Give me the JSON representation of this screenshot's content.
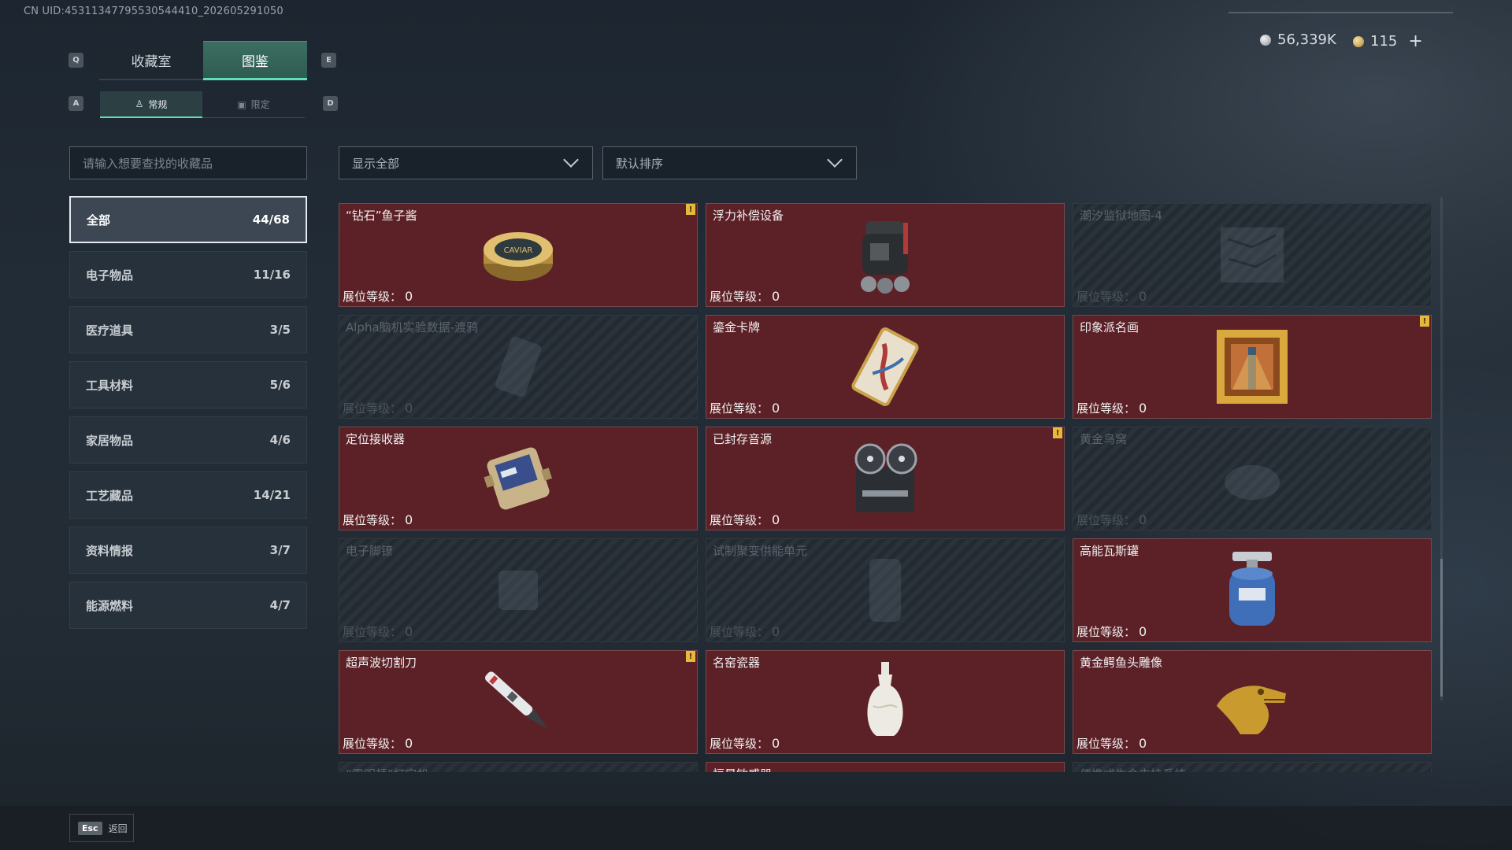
{
  "header": {
    "uid": "CN UID:4531134779553054441​0_202605291050",
    "keys": {
      "prev_tab": "Q",
      "next_tab": "E",
      "prev_sub": "A",
      "next_sub": "D"
    },
    "tabs": [
      {
        "label": "收藏室",
        "active": false
      },
      {
        "label": "图鉴",
        "active": true
      }
    ],
    "subtabs": [
      {
        "label": "常规",
        "active": true,
        "icon": "figure-icon"
      },
      {
        "label": "限定",
        "active": false,
        "icon": "image-icon"
      }
    ],
    "currency": {
      "silver": "56,339K",
      "gold": "115",
      "add": "+"
    }
  },
  "sidebar": {
    "search_placeholder": "请输入想要查找的收藏品",
    "categories": [
      {
        "label": "全部",
        "count": "44/68",
        "active": true
      },
      {
        "label": "电子物品",
        "count": "11/16"
      },
      {
        "label": "医疗道具",
        "count": "3/5"
      },
      {
        "label": "工具材料",
        "count": "5/6"
      },
      {
        "label": "家居物品",
        "count": "4/6"
      },
      {
        "label": "工艺藏品",
        "count": "14/21"
      },
      {
        "label": "资料情报",
        "count": "3/7"
      },
      {
        "label": "能源燃料",
        "count": "4/7"
      }
    ]
  },
  "filters": {
    "show": "显示全部",
    "sort": "默认排序"
  },
  "level_label": "展位等级：",
  "items": [
    {
      "name": "“钻石”鱼子酱",
      "level": "0",
      "owned": true,
      "new": true,
      "icon": "caviar-tin-icon"
    },
    {
      "name": "浮力补偿设备",
      "level": "0",
      "owned": true,
      "new": false,
      "icon": "buoyancy-device-icon"
    },
    {
      "name": "潮汐监狱地图-4",
      "level": "0",
      "owned": false,
      "new": false,
      "icon": "map-icon"
    },
    {
      "name": "Alpha脑机实验数据-渡鸦",
      "level": "0",
      "owned": false,
      "new": false,
      "icon": "data-drive-icon"
    },
    {
      "name": "鎏金卡牌",
      "level": "0",
      "owned": true,
      "new": false,
      "icon": "gilded-card-icon"
    },
    {
      "name": "印象派名画",
      "level": "0",
      "owned": true,
      "new": true,
      "icon": "painting-icon"
    },
    {
      "name": "定位接收器",
      "level": "0",
      "owned": true,
      "new": false,
      "icon": "receiver-icon"
    },
    {
      "name": "已封存音源",
      "level": "0",
      "owned": true,
      "new": true,
      "icon": "tape-recorder-icon"
    },
    {
      "name": "黄金鸟窝",
      "level": "0",
      "owned": false,
      "new": false,
      "icon": "bird-nest-icon"
    },
    {
      "name": "电子脚镣",
      "level": "0",
      "owned": false,
      "new": false,
      "icon": "ankle-monitor-icon"
    },
    {
      "name": "试制聚变供能单元",
      "level": "0",
      "owned": false,
      "new": false,
      "icon": "fusion-cell-icon"
    },
    {
      "name": "高能瓦斯罐",
      "level": "0",
      "owned": true,
      "new": false,
      "icon": "gas-canister-icon"
    },
    {
      "name": "超声波切割刀",
      "level": "0",
      "owned": true,
      "new": true,
      "icon": "ultrasonic-knife-icon"
    },
    {
      "name": "名窑瓷器",
      "level": "0",
      "owned": true,
      "new": false,
      "icon": "porcelain-vase-icon"
    },
    {
      "name": "黄金鳄鱼头雕像",
      "level": "0",
      "owned": true,
      "new": false,
      "icon": "crocodile-statue-icon"
    },
    {
      "name": "“雷明顿”打字机",
      "level": "",
      "owned": false,
      "new": false,
      "icon": "typewriter-icon"
    },
    {
      "name": "恒星敏感器",
      "level": "",
      "owned": true,
      "new": false,
      "icon": "star-sensor-icon"
    },
    {
      "name": "便携式生命支持系统",
      "level": "",
      "owned": false,
      "new": false,
      "icon": "life-support-icon"
    }
  ],
  "footer": {
    "key": "Esc",
    "label": "返回"
  }
}
